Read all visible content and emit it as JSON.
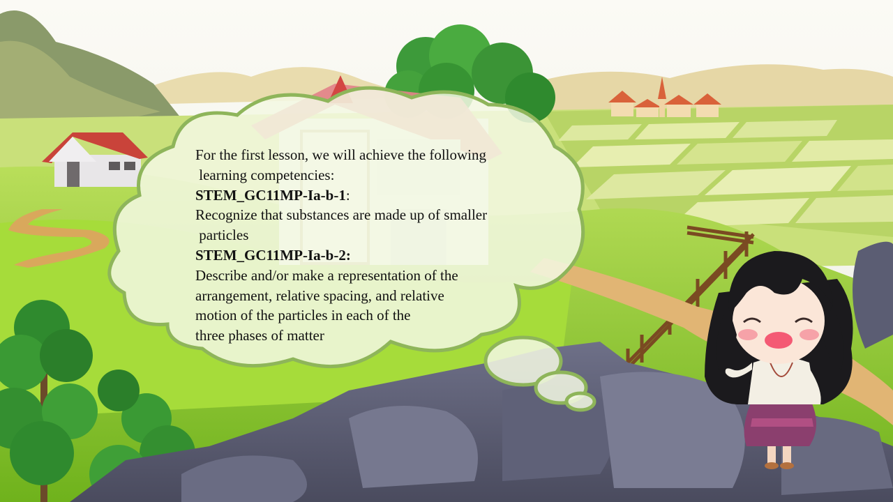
{
  "slide": {
    "intro_line1": "For the first lesson, we will achieve the following",
    "intro_line2": " learning competencies:",
    "competency1_code": "STEM_GC11MP-Ia-b-1",
    "competency1_colon": ":",
    "competency1_line1": "Recognize that substances are made up of smaller",
    "competency1_line2": " particles",
    "competency2_code": "STEM_GC11MP-Ia-b-2:",
    "competency2_line1": "Describe and/or make a representation of the",
    "competency2_line2": "arrangement, relative spacing, and relative",
    "competency2_line3": "motion of the particles in each of the",
    "competency2_line4": "three phases of matter"
  },
  "colors": {
    "sky": "#f4f1e6",
    "grass": "#8fcf2a",
    "bubble_fill": "#f3f8e3",
    "bubble_stroke": "#8eb55a",
    "rock": "#5b5d73"
  }
}
